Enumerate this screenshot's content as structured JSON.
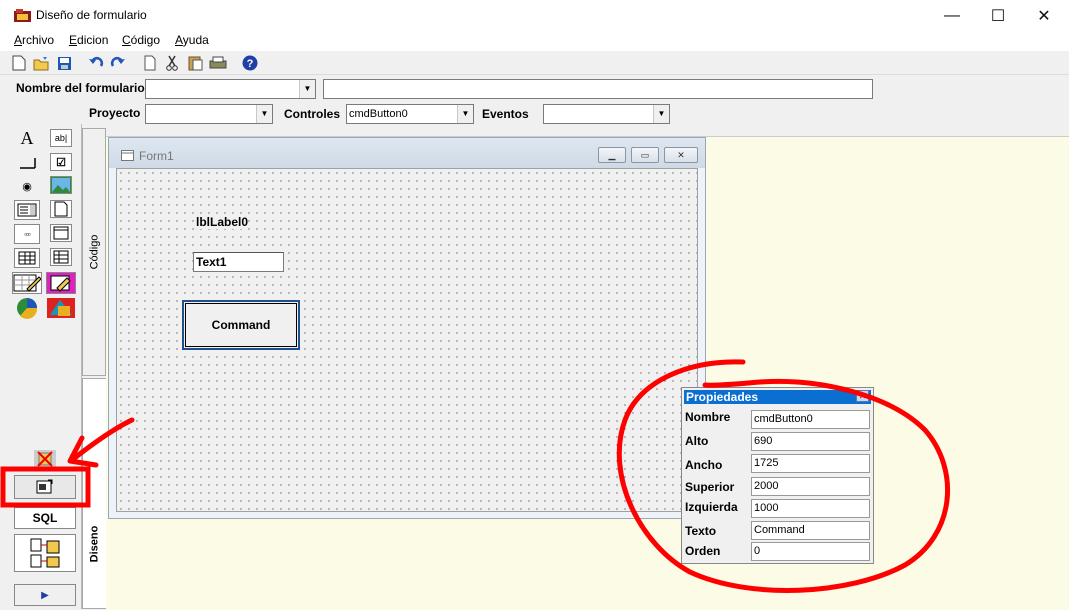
{
  "window": {
    "title": "Diseño de formulario",
    "controls": {
      "minimize": "—",
      "maximize": "☐",
      "close": "✕"
    }
  },
  "menu": [
    {
      "label": "Archivo",
      "accel": "A",
      "rest": "rchivo"
    },
    {
      "label": "Edicion",
      "accel": "E",
      "rest": "dicion"
    },
    {
      "label": "Código",
      "accel": "C",
      "rest": "ódigo"
    },
    {
      "label": "Ayuda",
      "accel": "A",
      "rest": "yuda"
    }
  ],
  "toolbar": {
    "icons": [
      "new-file-icon",
      "open-folder-icon",
      "save-icon",
      "undo-icon",
      "redo-icon",
      "copy-icon",
      "cut-icon",
      "paste-icon",
      "print-icon",
      "help-icon"
    ]
  },
  "fields": {
    "form_name_label": "Nombre del formulario",
    "form_name_value": "",
    "project_label": "Proyecto",
    "project_value": "",
    "controls_label": "Controles",
    "controls_value": "cmdButton0",
    "events_label": "Eventos",
    "events_value": ""
  },
  "tabs": {
    "code": "Código",
    "design": "Diseno"
  },
  "sidebar": {
    "sql_label": "SQL"
  },
  "form": {
    "title": "Form1",
    "label_text": "lblLabel0",
    "textbox_text": "Text1",
    "button_text": "Command"
  },
  "properties": {
    "title": "Propiedades",
    "rows": [
      {
        "name": "Nombre",
        "value": "cmdButton0"
      },
      {
        "name": "Alto",
        "value": "690"
      },
      {
        "name": "Ancho",
        "value": "1725"
      },
      {
        "name": "Superior",
        "value": "2000"
      },
      {
        "name": "Izquierda",
        "value": "1000"
      },
      {
        "name": "Texto",
        "value": "Command"
      },
      {
        "name": "Orden",
        "value": "0"
      }
    ]
  },
  "colors": {
    "annotation_red": "#ff0000",
    "props_title_bg": "#0a6fd1",
    "work_area_bg": "#fcfbe6"
  }
}
